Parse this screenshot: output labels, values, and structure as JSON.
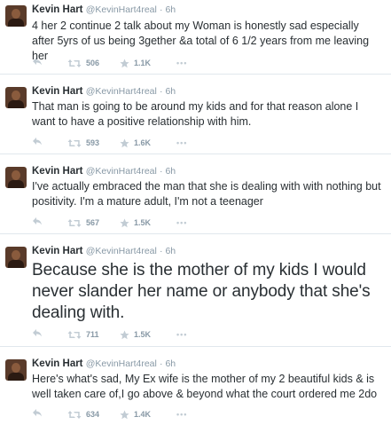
{
  "tweets": [
    {
      "name": "Kevin Hart",
      "handle": "@KevinHart4real",
      "time": "· 6h",
      "text": "4 her 2 continue 2 talk about my Woman is honestly sad especially after 5yrs of us being 3gether &a total of 6 1/2 years from me leaving her",
      "retweets": "506",
      "likes": "1.1K",
      "more": "•••"
    },
    {
      "name": "Kevin Hart",
      "handle": "@KevinHart4real",
      "time": "· 6h",
      "text": "That man is going to be around my kids and for that reason alone I want to have a positive relationship with him.",
      "retweets": "593",
      "likes": "1.6K",
      "more": "•••"
    },
    {
      "name": "Kevin Hart",
      "handle": "@KevinHart4real",
      "time": "· 6h",
      "text": "I've actually embraced the man that she is dealing with with nothing but positivity. I'm a mature adult, I'm not a teenager",
      "retweets": "567",
      "likes": "1.5K",
      "more": "•••"
    },
    {
      "name": "Kevin Hart",
      "handle": "@KevinHart4real",
      "time": "· 6h",
      "text": "Because she is the mother of my kids I would never slander her name or anybody that she's dealing with.",
      "retweets": "711",
      "likes": "1.5K",
      "more": "•••"
    },
    {
      "name": "Kevin Hart",
      "handle": "@KevinHart4real",
      "time": "· 6h",
      "text": "Here's what's sad, My Ex wife is the mother of my 2 beautiful kids & is well taken care of,I go above & beyond what the court ordered me 2do",
      "retweets": "634",
      "likes": "1.4K",
      "more": "•••"
    }
  ],
  "colors": {
    "text": "#292f33",
    "muted": "#8899a6",
    "divider": "#e1e8ed"
  }
}
